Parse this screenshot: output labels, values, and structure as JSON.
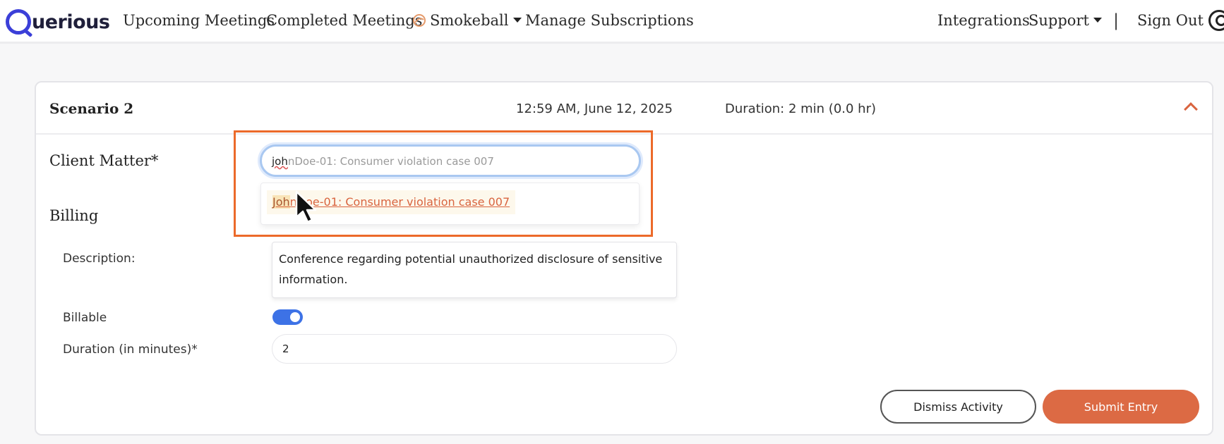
{
  "navbar": {
    "logo": "uerious",
    "links": {
      "upcoming": "Upcoming Meetings",
      "completed": "Completed Meetings",
      "smokeball": "Smokeball",
      "subscriptions": "Manage Subscriptions",
      "integrations": "Integrations",
      "support": "Support",
      "separator": "|",
      "signout": "Sign Out"
    }
  },
  "card": {
    "title": "Scenario 2",
    "time": "12:59 AM, June 12, 2025",
    "duration": "Duration: 2 min (0.0 hr)",
    "client_matter": {
      "label": "Client Matter*",
      "typed": "joh",
      "suggestion_rest": "nDoe-01: Consumer violation case 007",
      "option_highlight": "Joh",
      "option_rest": "nDoe-01: Consumer violation case 007"
    },
    "billing": {
      "label": "Billing",
      "description_label": "Description:",
      "description_value": "Conference regarding potential unauthorized disclosure of sensitive information.",
      "billable_label": "Billable",
      "billable": true,
      "duration_label": "Duration (in minutes)*",
      "duration_value": "2"
    },
    "actions": {
      "dismiss": "Dismiss Activity",
      "submit": "Submit Entry"
    }
  },
  "colors": {
    "accent": "#dc6a44",
    "brand": "#3b3fd8",
    "toggle": "#3d72e6",
    "highlight_frame": "#ec6a2a"
  }
}
